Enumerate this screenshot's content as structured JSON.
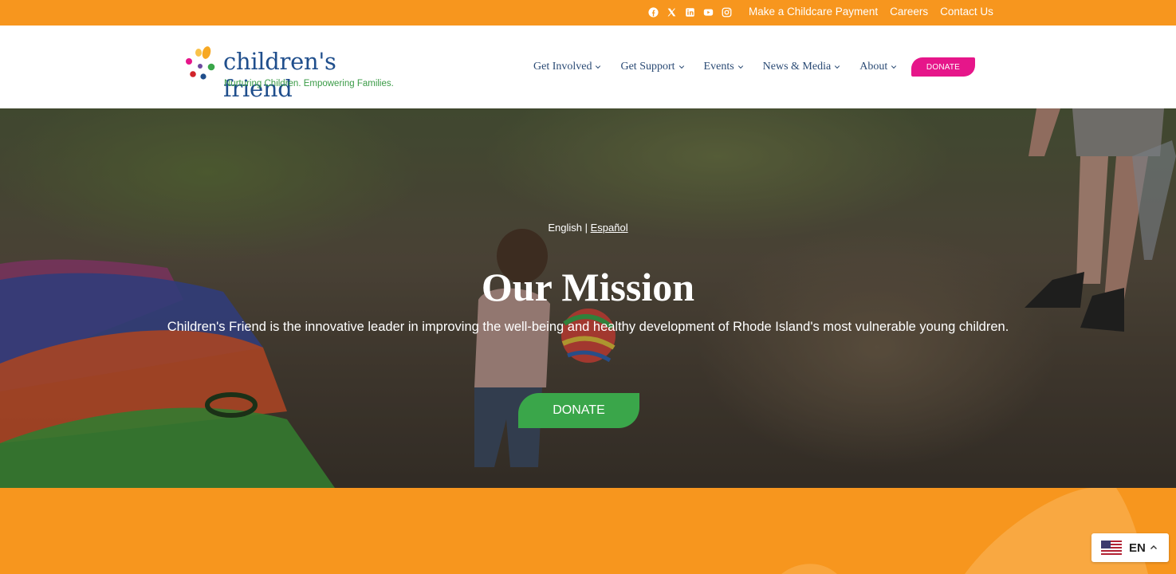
{
  "topbar": {
    "social_icons": [
      "facebook-icon",
      "x-twitter-icon",
      "linkedin-icon",
      "youtube-icon",
      "instagram-icon"
    ],
    "links": [
      "Make a Childcare Payment",
      "Careers",
      "Contact Us"
    ]
  },
  "header": {
    "logo": {
      "brand": "children's friend",
      "tagline": "Nurturing Children. Empowering Families."
    },
    "nav": [
      {
        "label": "Get Involved"
      },
      {
        "label": "Get Support"
      },
      {
        "label": "Events"
      },
      {
        "label": "News & Media"
      },
      {
        "label": "About"
      }
    ],
    "donate_label": "DONATE"
  },
  "hero": {
    "lang_en": "English",
    "lang_sep": "|",
    "lang_es": "Español",
    "title": "Our Mission",
    "mission": "Children's Friend is the innovative leader in improving the well-being and healthy development of Rhode Island's most vulnerable young children.",
    "donate_label": "DONATE"
  },
  "language_selector": {
    "code": "EN",
    "flag": "us-flag-icon"
  },
  "colors": {
    "orange": "#f7961e",
    "navy": "#1f4e8c",
    "pink": "#e6168a",
    "green": "#3aa64a"
  }
}
